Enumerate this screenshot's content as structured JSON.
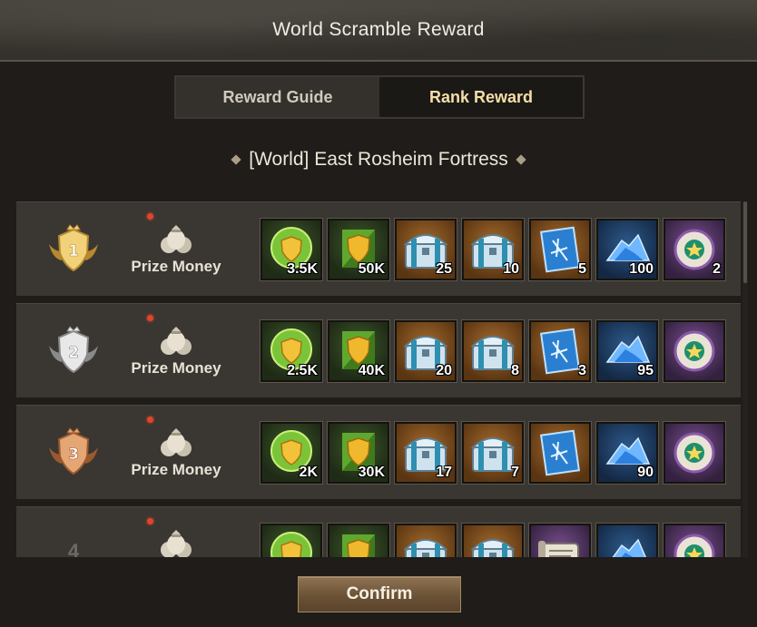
{
  "header": {
    "title": "World Scramble Reward"
  },
  "tabs": [
    {
      "label": "Reward Guide",
      "active": false
    },
    {
      "label": "Rank Reward",
      "active": true
    }
  ],
  "section": {
    "title": "[World] East Rosheim Fortress"
  },
  "prize_label": "Prize Money",
  "rows": [
    {
      "rank": "1",
      "badge": "gold",
      "items": [
        {
          "icon": "shield-coin-icon",
          "tier": "green",
          "qty": "3.5K"
        },
        {
          "icon": "shield-banner-icon",
          "tier": "green",
          "qty": "50K"
        },
        {
          "icon": "chest-icon",
          "tier": "brown",
          "qty": "25"
        },
        {
          "icon": "chest-icon",
          "tier": "brown",
          "qty": "10"
        },
        {
          "icon": "blueprint-icon",
          "tier": "brown",
          "qty": "5"
        },
        {
          "icon": "crystal-icon",
          "tier": "blue",
          "qty": "100"
        },
        {
          "icon": "orb-icon",
          "tier": "purple",
          "qty": "2"
        }
      ]
    },
    {
      "rank": "2",
      "badge": "silver",
      "items": [
        {
          "icon": "shield-coin-icon",
          "tier": "green",
          "qty": "2.5K"
        },
        {
          "icon": "shield-banner-icon",
          "tier": "green",
          "qty": "40K"
        },
        {
          "icon": "chest-icon",
          "tier": "brown",
          "qty": "20"
        },
        {
          "icon": "chest-icon",
          "tier": "brown",
          "qty": "8"
        },
        {
          "icon": "blueprint-icon",
          "tier": "brown",
          "qty": "3"
        },
        {
          "icon": "crystal-icon",
          "tier": "blue",
          "qty": "95"
        },
        {
          "icon": "orb-icon",
          "tier": "purple",
          "qty": ""
        }
      ]
    },
    {
      "rank": "3",
      "badge": "bronze",
      "items": [
        {
          "icon": "shield-coin-icon",
          "tier": "green",
          "qty": "2K"
        },
        {
          "icon": "shield-banner-icon",
          "tier": "green",
          "qty": "30K"
        },
        {
          "icon": "chest-icon",
          "tier": "brown",
          "qty": "17"
        },
        {
          "icon": "chest-icon",
          "tier": "brown",
          "qty": "7"
        },
        {
          "icon": "blueprint-icon",
          "tier": "brown",
          "qty": ""
        },
        {
          "icon": "crystal-icon",
          "tier": "blue",
          "qty": "90"
        },
        {
          "icon": "orb-icon",
          "tier": "purple",
          "qty": ""
        }
      ]
    },
    {
      "rank": "4",
      "badge": "none",
      "items": [
        {
          "icon": "shield-coin-icon",
          "tier": "green",
          "qty": ""
        },
        {
          "icon": "shield-banner-icon",
          "tier": "green",
          "qty": ""
        },
        {
          "icon": "chest-icon",
          "tier": "brown",
          "qty": ""
        },
        {
          "icon": "chest-icon",
          "tier": "brown",
          "qty": ""
        },
        {
          "icon": "scroll-icon",
          "tier": "purple",
          "qty": ""
        },
        {
          "icon": "crystal-icon",
          "tier": "blue",
          "qty": ""
        },
        {
          "icon": "orb-icon",
          "tier": "purple",
          "qty": ""
        }
      ]
    }
  ],
  "footer": {
    "confirm_label": "Confirm"
  },
  "colors": {
    "gold": "#d9b25a",
    "silver": "#b9b9b9",
    "bronze": "#c07a4a",
    "accent_tab": "#f4dfa8"
  }
}
